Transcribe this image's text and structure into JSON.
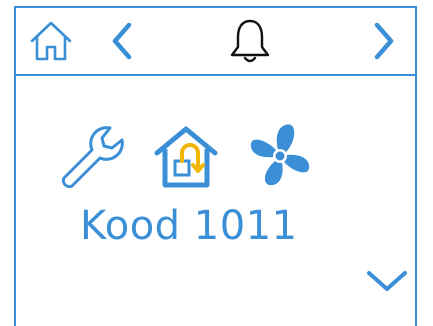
{
  "status": {
    "code_text": "Kood 1011"
  },
  "icons": {
    "home": "home-icon",
    "prev": "chevron-left-icon",
    "bell": "bell-icon",
    "next": "chevron-right-icon",
    "wrench": "wrench-icon",
    "house_mode": "house-return-icon",
    "fan": "fan-icon",
    "down": "chevron-down-icon"
  },
  "colors": {
    "accent": "#3a8fd6",
    "highlight": "#f2b705",
    "frame": "#3a8fd6"
  }
}
